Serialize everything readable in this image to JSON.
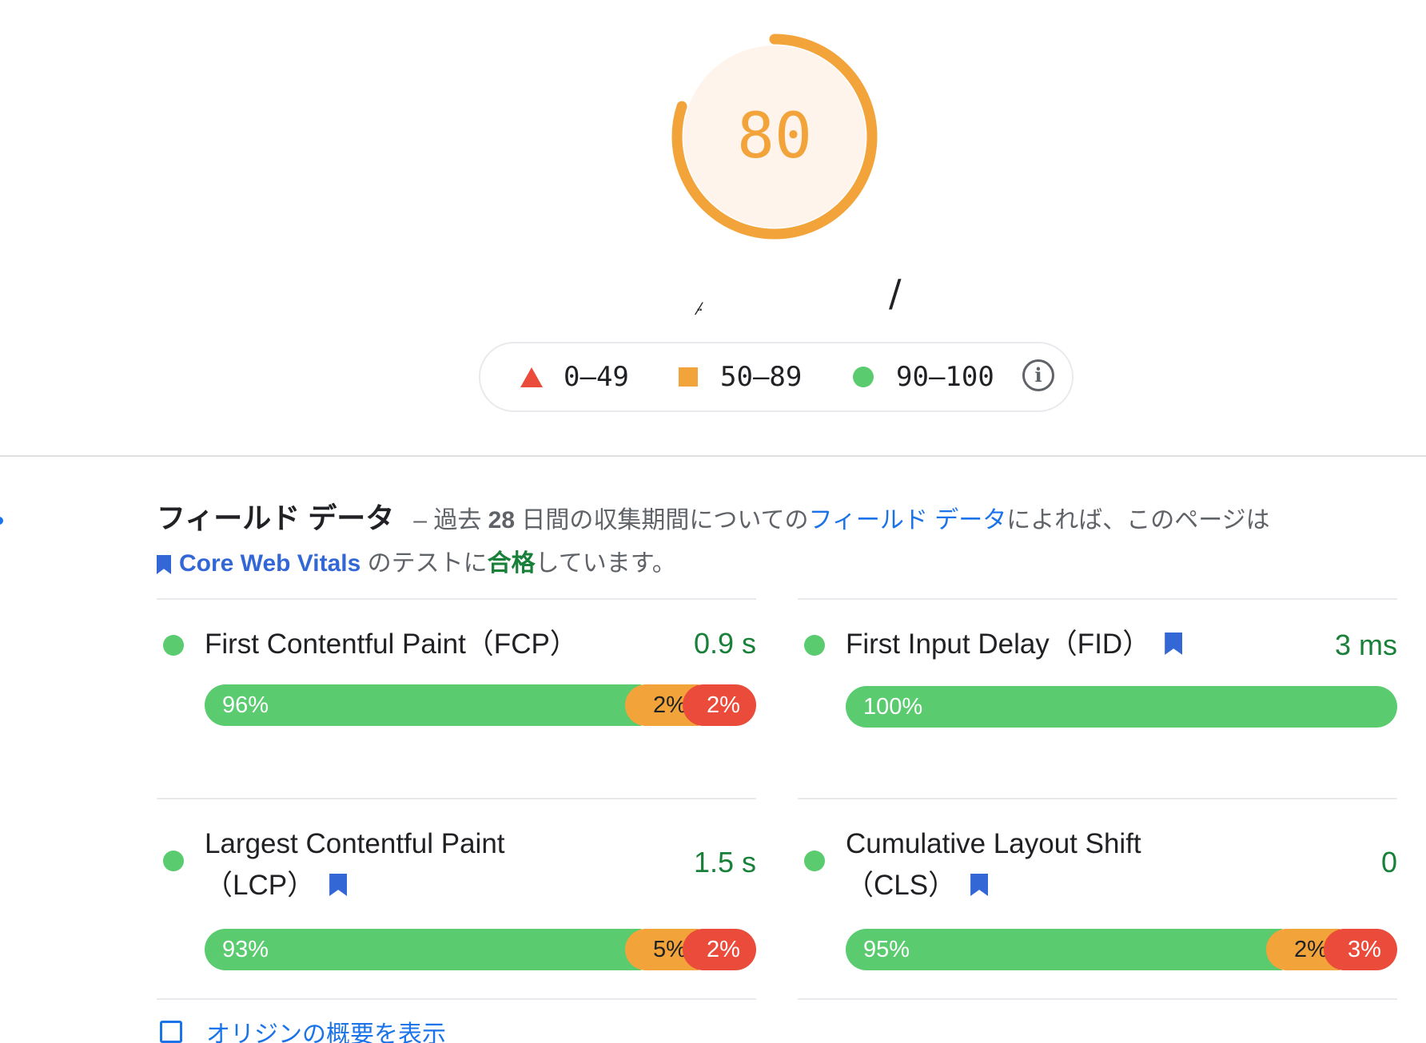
{
  "gauge": {
    "score": "80",
    "score_fraction": 0.8,
    "color": "#f2a43a",
    "url_partial": "·⁄·",
    "url_slash": "/"
  },
  "legend": {
    "items": [
      {
        "range": "0–49",
        "shape": "triangle",
        "color": "#eb4b3a"
      },
      {
        "range": "50–89",
        "shape": "square",
        "color": "#f2a43a"
      },
      {
        "range": "90–100",
        "shape": "circle",
        "color": "#5acb6f"
      }
    ],
    "info_icon": "info-icon",
    "info_glyph": "i"
  },
  "field_data": {
    "title": "フィールド データ",
    "dash": "–",
    "desc_1": " 過去 ",
    "days": "28",
    "desc_2": " 日間の収集期間についての",
    "link": "フィールド データ",
    "desc_3": "によれば、このページは",
    "cwv": "Core Web Vitals",
    "desc_4": " のテストに",
    "pass": "合格",
    "desc_5": "しています。"
  },
  "metrics": [
    {
      "name": "First Contentful Paint（FCP）",
      "value": "0.9 s",
      "status": "good",
      "core": false,
      "dist": {
        "good": "96%",
        "average": "2%",
        "poor": "2%"
      },
      "dist_values": [
        96,
        2,
        2
      ]
    },
    {
      "name": "First Input Delay（FID）",
      "value": "3 ms",
      "status": "good",
      "core": true,
      "dist": {
        "good": "100%"
      },
      "dist_values": [
        100,
        0,
        0
      ]
    },
    {
      "name_line1": "Largest Contentful Paint",
      "name_line2": "（LCP）",
      "value": "1.5 s",
      "status": "good",
      "core": true,
      "dist": {
        "good": "93%",
        "average": "5%",
        "poor": "2%"
      },
      "dist_values": [
        93,
        5,
        2
      ]
    },
    {
      "name_line1": "Cumulative Layout Shift",
      "name_line2": "（CLS）",
      "value": "0",
      "status": "good",
      "core": true,
      "dist": {
        "good": "95%",
        "average": "2%",
        "poor": "3%"
      },
      "dist_values": [
        95,
        2,
        3
      ]
    }
  ],
  "origin_toggle": {
    "label": "オリジンの概要を表示"
  }
}
